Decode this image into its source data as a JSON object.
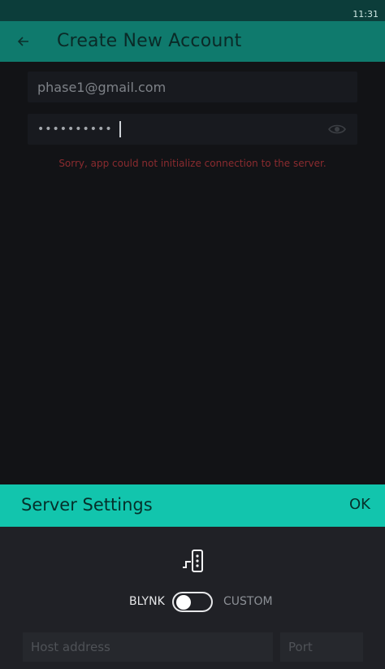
{
  "status_bar": {
    "time": "11:31"
  },
  "app_bar": {
    "back_icon": "arrow-back-icon",
    "title": "Create New Account"
  },
  "form": {
    "email": {
      "value": "phase1@gmail.com"
    },
    "password": {
      "value": "••••••••••",
      "visibility_icon": "eye-icon"
    },
    "error": "Sorry, app could not initialize connection to the server."
  },
  "server_settings": {
    "title": "Server Settings",
    "ok_label": "OK",
    "icon": "server-icon",
    "toggle": {
      "left_label": "BLYNK",
      "right_label": "CUSTOM",
      "selected": "BLYNK"
    },
    "host": {
      "placeholder": "Host address"
    },
    "port": {
      "placeholder": "Port"
    }
  },
  "colors": {
    "accent": "#12c5ad",
    "app_bar": "#0f7a6d",
    "error": "#8a2b2f",
    "background": "#101114",
    "sheet": "#202126"
  }
}
